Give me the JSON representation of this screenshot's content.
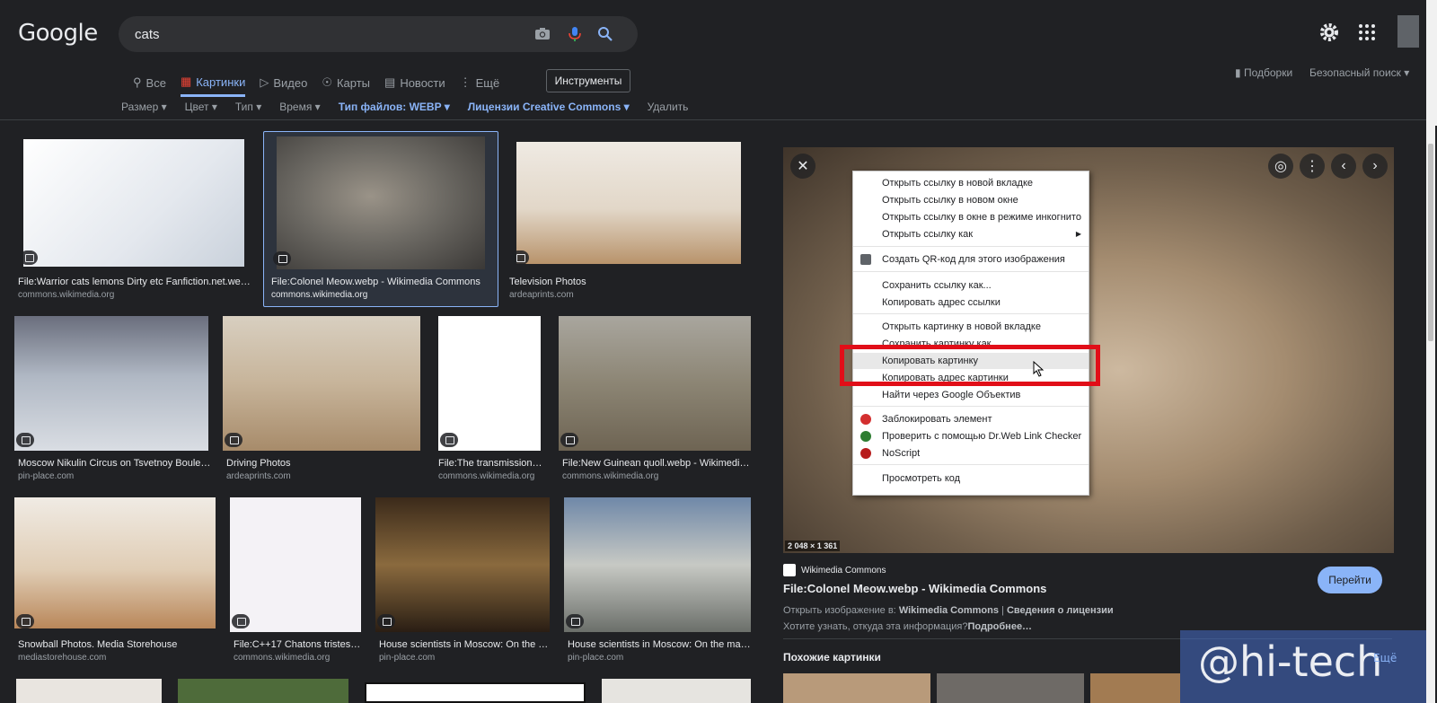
{
  "header": {
    "logo": "Google",
    "search_value": "cats",
    "tabs": [
      {
        "label": "Все",
        "icon": "search-icon"
      },
      {
        "label": "Картинки",
        "icon": "images-icon",
        "active": true
      },
      {
        "label": "Видео",
        "icon": "video-icon"
      },
      {
        "label": "Карты",
        "icon": "map-pin-icon"
      },
      {
        "label": "Новости",
        "icon": "news-icon"
      },
      {
        "label": "Ещё",
        "icon": "more-vert-icon"
      }
    ],
    "tools_label": "Инструменты",
    "collections_label": "Подборки",
    "safesearch_label": "Безопасный поиск",
    "filters": [
      "Размер",
      "Цвет",
      "Тип",
      "Время",
      "Тип файлов: WEBP",
      "Лицензии Creative Commons",
      "Удалить"
    ]
  },
  "results": [
    {
      "title": "File:Warrior cats lemons Dirty etc Fanfiction.net.webp -...",
      "source": "commons.wikimedia.org"
    },
    {
      "title": "File:Colonel Meow.webp - Wikimedia Commons",
      "source": "commons.wikimedia.org"
    },
    {
      "title": "Television Photos",
      "source": "ardeaprints.com"
    },
    {
      "title": "Moscow Nikulin Circus on Tsvetnoy Bouleva...",
      "source": "pin-place.com"
    },
    {
      "title": "Driving Photos",
      "source": "ardeaprints.com"
    },
    {
      "title": "File:The transmission c...",
      "source": "commons.wikimedia.org"
    },
    {
      "title": "File:New Guinean quoll.webp - Wikimedia C...",
      "source": "commons.wikimedia.org"
    },
    {
      "title": "Snowball Photos. Media Storehouse",
      "source": "mediastorehouse.com"
    },
    {
      "title": "File:C++17 Chatons tristes O...",
      "source": "commons.wikimedia.org"
    },
    {
      "title": "House scientists in Moscow: On the m...",
      "source": "pin-place.com"
    },
    {
      "title": "House scientists in Moscow: On the map, ...",
      "source": "pin-place.com"
    }
  ],
  "preview": {
    "dimensions": "2 048 × 1 361",
    "source_name": "Wikimedia Commons",
    "title": "File:Colonel Meow.webp - Wikimedia Commons",
    "visit_label": "Перейти",
    "open_in_prefix": "Открыть изображение в:",
    "open_in_site": "Wikimedia Commons",
    "license_sep": "|",
    "license_label": "Сведения о лицензии",
    "info_question": "Хотите узнать, откуда эта информация?",
    "info_more": "Подробнее…",
    "similar_label": "Похожие картинки",
    "more_label": "Ещё"
  },
  "context_menu": {
    "items": [
      "Открыть ссылку в новой вкладке",
      "Открыть ссылку в новом окне",
      "Открыть ссылку в окне в режиме инкогнито",
      "Открыть ссылку как",
      "Создать QR-код для этого изображения",
      "Сохранить ссылку как...",
      "Копировать адрес ссылки",
      "Открыть картинку в новой вкладке",
      "Сохранить картинку как...",
      "Копировать картинку",
      "Копировать адрес картинки",
      "Найти через Google Объектив",
      "Заблокировать элемент",
      "Проверить с помощью Dr.Web Link Checker",
      "NoScript",
      "Просмотреть код"
    ],
    "highlighted": "Копировать картинку"
  },
  "watermark": "@hi-tech",
  "colors": {
    "background": "#202124",
    "accent": "#8ab4f8",
    "highlight_box": "#e10e18"
  }
}
